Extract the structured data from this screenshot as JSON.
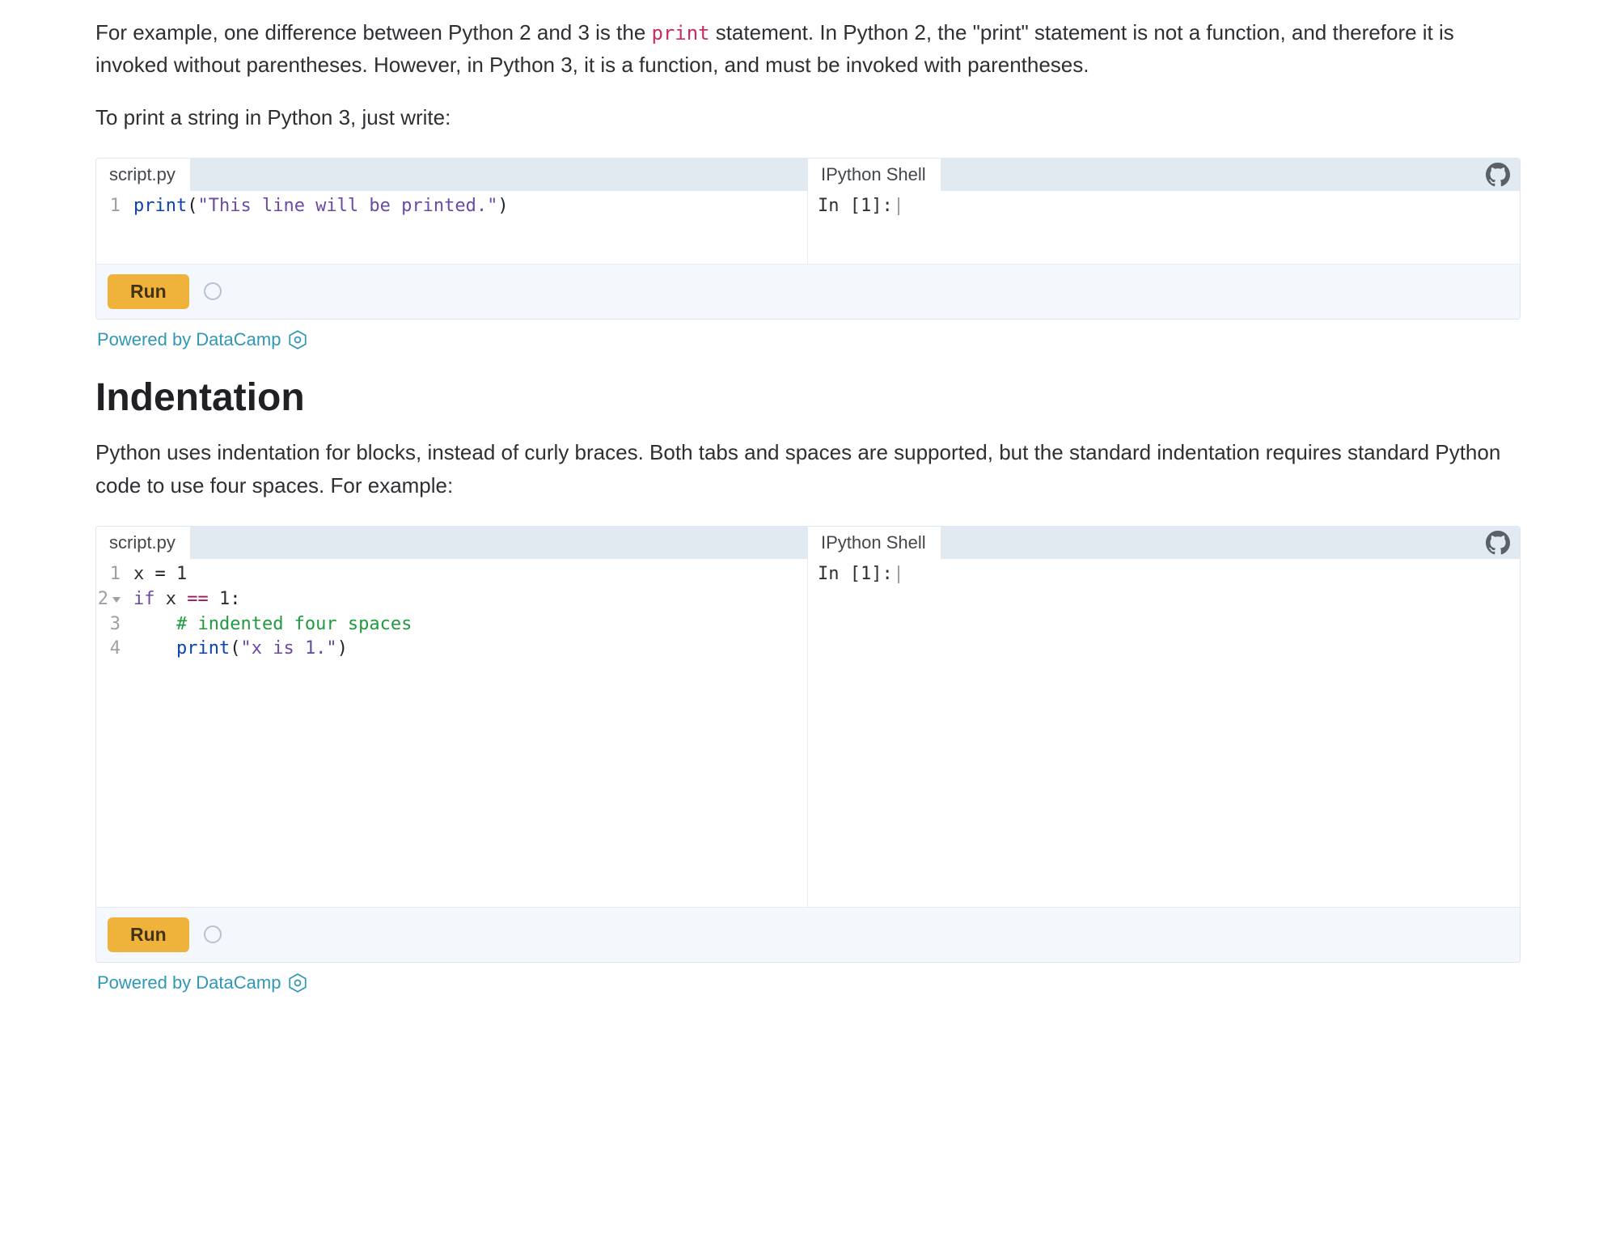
{
  "intro": {
    "p1_a": "For example, one difference between Python 2 and 3 is the ",
    "p1_code": "print",
    "p1_b": " statement. In Python 2, the \"print\" statement is not a function, and therefore it is invoked without parentheses. However, in Python 3, it is a function, and must be invoked with parentheses.",
    "p2": "To print a string in Python 3, just write:"
  },
  "ide1": {
    "script_tab": "script.py",
    "shell_tab": "IPython Shell",
    "shell_prompt": "In [1]:",
    "run_label": "Run",
    "lines": [
      {
        "n": "1",
        "tokens": {
          "fn": "print",
          "paren_o": "(",
          "str": "\"This line will be printed.\"",
          "paren_c": ")"
        }
      }
    ]
  },
  "attribution": "Powered by DataCamp",
  "indentation": {
    "heading": "Indentation",
    "p1": "Python uses indentation for blocks, instead of curly braces. Both tabs and spaces are supported, but the standard indentation requires standard Python code to use four spaces. For example:"
  },
  "ide2": {
    "script_tab": "script.py",
    "shell_tab": "IPython Shell",
    "shell_prompt": "In [1]:",
    "run_label": "Run",
    "lines": [
      {
        "n": "1",
        "id": "x",
        "eq": " = ",
        "num": "1"
      },
      {
        "n": "2",
        "kw": "if",
        "sp": " ",
        "id": "x",
        "sp2": " ",
        "op": "==",
        "sp3": " ",
        "num": "1",
        "colon": ":"
      },
      {
        "n": "3",
        "indent": "    ",
        "cmt": "# indented four spaces"
      },
      {
        "n": "4",
        "indent": "    ",
        "fn": "print",
        "paren_o": "(",
        "str": "\"x is 1.\"",
        "paren_c": ")"
      }
    ]
  }
}
